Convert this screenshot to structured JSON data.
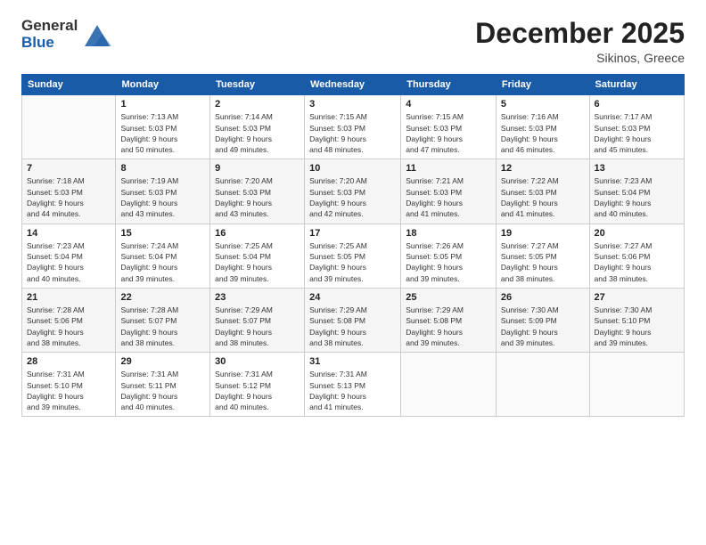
{
  "header": {
    "logo_line1": "General",
    "logo_line2": "Blue",
    "month": "December 2025",
    "location": "Sikinos, Greece"
  },
  "weekdays": [
    "Sunday",
    "Monday",
    "Tuesday",
    "Wednesday",
    "Thursday",
    "Friday",
    "Saturday"
  ],
  "weeks": [
    [
      {
        "day": "",
        "info": ""
      },
      {
        "day": "1",
        "info": "Sunrise: 7:13 AM\nSunset: 5:03 PM\nDaylight: 9 hours\nand 50 minutes."
      },
      {
        "day": "2",
        "info": "Sunrise: 7:14 AM\nSunset: 5:03 PM\nDaylight: 9 hours\nand 49 minutes."
      },
      {
        "day": "3",
        "info": "Sunrise: 7:15 AM\nSunset: 5:03 PM\nDaylight: 9 hours\nand 48 minutes."
      },
      {
        "day": "4",
        "info": "Sunrise: 7:15 AM\nSunset: 5:03 PM\nDaylight: 9 hours\nand 47 minutes."
      },
      {
        "day": "5",
        "info": "Sunrise: 7:16 AM\nSunset: 5:03 PM\nDaylight: 9 hours\nand 46 minutes."
      },
      {
        "day": "6",
        "info": "Sunrise: 7:17 AM\nSunset: 5:03 PM\nDaylight: 9 hours\nand 45 minutes."
      }
    ],
    [
      {
        "day": "7",
        "info": "Sunrise: 7:18 AM\nSunset: 5:03 PM\nDaylight: 9 hours\nand 44 minutes."
      },
      {
        "day": "8",
        "info": "Sunrise: 7:19 AM\nSunset: 5:03 PM\nDaylight: 9 hours\nand 43 minutes."
      },
      {
        "day": "9",
        "info": "Sunrise: 7:20 AM\nSunset: 5:03 PM\nDaylight: 9 hours\nand 43 minutes."
      },
      {
        "day": "10",
        "info": "Sunrise: 7:20 AM\nSunset: 5:03 PM\nDaylight: 9 hours\nand 42 minutes."
      },
      {
        "day": "11",
        "info": "Sunrise: 7:21 AM\nSunset: 5:03 PM\nDaylight: 9 hours\nand 41 minutes."
      },
      {
        "day": "12",
        "info": "Sunrise: 7:22 AM\nSunset: 5:03 PM\nDaylight: 9 hours\nand 41 minutes."
      },
      {
        "day": "13",
        "info": "Sunrise: 7:23 AM\nSunset: 5:04 PM\nDaylight: 9 hours\nand 40 minutes."
      }
    ],
    [
      {
        "day": "14",
        "info": "Sunrise: 7:23 AM\nSunset: 5:04 PM\nDaylight: 9 hours\nand 40 minutes."
      },
      {
        "day": "15",
        "info": "Sunrise: 7:24 AM\nSunset: 5:04 PM\nDaylight: 9 hours\nand 39 minutes."
      },
      {
        "day": "16",
        "info": "Sunrise: 7:25 AM\nSunset: 5:04 PM\nDaylight: 9 hours\nand 39 minutes."
      },
      {
        "day": "17",
        "info": "Sunrise: 7:25 AM\nSunset: 5:05 PM\nDaylight: 9 hours\nand 39 minutes."
      },
      {
        "day": "18",
        "info": "Sunrise: 7:26 AM\nSunset: 5:05 PM\nDaylight: 9 hours\nand 39 minutes."
      },
      {
        "day": "19",
        "info": "Sunrise: 7:27 AM\nSunset: 5:05 PM\nDaylight: 9 hours\nand 38 minutes."
      },
      {
        "day": "20",
        "info": "Sunrise: 7:27 AM\nSunset: 5:06 PM\nDaylight: 9 hours\nand 38 minutes."
      }
    ],
    [
      {
        "day": "21",
        "info": "Sunrise: 7:28 AM\nSunset: 5:06 PM\nDaylight: 9 hours\nand 38 minutes."
      },
      {
        "day": "22",
        "info": "Sunrise: 7:28 AM\nSunset: 5:07 PM\nDaylight: 9 hours\nand 38 minutes."
      },
      {
        "day": "23",
        "info": "Sunrise: 7:29 AM\nSunset: 5:07 PM\nDaylight: 9 hours\nand 38 minutes."
      },
      {
        "day": "24",
        "info": "Sunrise: 7:29 AM\nSunset: 5:08 PM\nDaylight: 9 hours\nand 38 minutes."
      },
      {
        "day": "25",
        "info": "Sunrise: 7:29 AM\nSunset: 5:08 PM\nDaylight: 9 hours\nand 39 minutes."
      },
      {
        "day": "26",
        "info": "Sunrise: 7:30 AM\nSunset: 5:09 PM\nDaylight: 9 hours\nand 39 minutes."
      },
      {
        "day": "27",
        "info": "Sunrise: 7:30 AM\nSunset: 5:10 PM\nDaylight: 9 hours\nand 39 minutes."
      }
    ],
    [
      {
        "day": "28",
        "info": "Sunrise: 7:31 AM\nSunset: 5:10 PM\nDaylight: 9 hours\nand 39 minutes."
      },
      {
        "day": "29",
        "info": "Sunrise: 7:31 AM\nSunset: 5:11 PM\nDaylight: 9 hours\nand 40 minutes."
      },
      {
        "day": "30",
        "info": "Sunrise: 7:31 AM\nSunset: 5:12 PM\nDaylight: 9 hours\nand 40 minutes."
      },
      {
        "day": "31",
        "info": "Sunrise: 7:31 AM\nSunset: 5:13 PM\nDaylight: 9 hours\nand 41 minutes."
      },
      {
        "day": "",
        "info": ""
      },
      {
        "day": "",
        "info": ""
      },
      {
        "day": "",
        "info": ""
      }
    ]
  ]
}
